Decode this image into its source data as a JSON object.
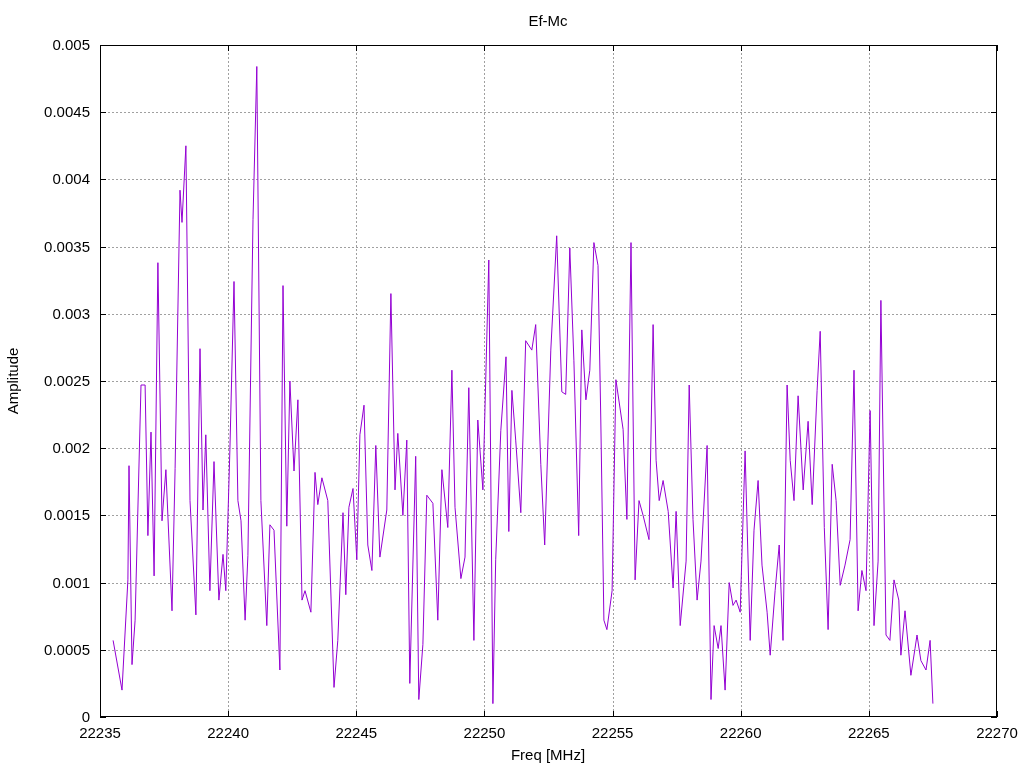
{
  "chart_data": {
    "type": "line",
    "grid": true,
    "title": "Ef-Mc",
    "xlabel": "Freq [MHz]",
    "ylabel": "Amplitude",
    "xlim": [
      22235,
      22270
    ],
    "ylim": [
      0,
      0.005
    ],
    "xticks": [
      22235,
      22240,
      22245,
      22250,
      22255,
      22260,
      22265,
      22270
    ],
    "yticks": [
      0,
      0.0005,
      0.001,
      0.0015,
      0.002,
      0.0025,
      0.003,
      0.0035,
      0.004,
      0.0045,
      0.005
    ],
    "x": [
      22235.51,
      22235.86,
      22236.09,
      22236.13,
      22236.25,
      22236.37,
      22236.6,
      22236.76,
      22236.87,
      22236.99,
      22237.11,
      22237.26,
      22237.42,
      22237.57,
      22237.81,
      22237.93,
      22238.12,
      22238.2,
      22238.35,
      22238.51,
      22238.74,
      22238.9,
      22239.02,
      22239.13,
      22239.29,
      22239.45,
      22239.64,
      22239.8,
      22239.91,
      22240.07,
      22240.23,
      22240.38,
      22240.5,
      22240.66,
      22240.77,
      22240.97,
      22241.12,
      22241.28,
      22241.51,
      22241.63,
      22241.79,
      22242.02,
      22242.14,
      22242.29,
      22242.41,
      22242.57,
      22242.72,
      22242.88,
      22243.0,
      22243.23,
      22243.39,
      22243.5,
      22243.66,
      22243.89,
      22244.13,
      22244.28,
      22244.48,
      22244.59,
      22244.71,
      22244.87,
      22245.02,
      22245.14,
      22245.3,
      22245.45,
      22245.61,
      22245.76,
      22245.92,
      22246.19,
      22246.35,
      22246.51,
      22246.62,
      22246.82,
      22246.97,
      22247.09,
      22247.32,
      22247.44,
      22247.6,
      22247.75,
      22247.99,
      22248.18,
      22248.34,
      22248.57,
      22248.73,
      22248.85,
      22249.08,
      22249.24,
      22249.39,
      22249.59,
      22249.74,
      22249.94,
      22250.17,
      22250.33,
      22250.44,
      22250.64,
      22250.84,
      22250.95,
      22251.07,
      22251.22,
      22251.42,
      22251.61,
      22251.85,
      22252.0,
      22252.2,
      22252.35,
      22252.59,
      22252.82,
      22253.02,
      22253.17,
      22253.33,
      22253.49,
      22253.68,
      22253.8,
      22253.96,
      22254.11,
      22254.27,
      22254.43,
      22254.54,
      22254.66,
      22254.78,
      22254.98,
      22255.13,
      22255.41,
      22255.56,
      22255.72,
      22255.88,
      22256.03,
      22256.19,
      22256.42,
      22256.58,
      22256.7,
      22256.82,
      22256.97,
      22257.17,
      22257.36,
      22257.48,
      22257.64,
      22257.87,
      22257.99,
      22258.14,
      22258.3,
      22258.45,
      22258.69,
      22258.84,
      22258.96,
      22259.12,
      22259.23,
      22259.39,
      22259.55,
      22259.7,
      22259.82,
      22259.98,
      22260.17,
      22260.37,
      22260.52,
      22260.68,
      22260.83,
      22261.03,
      22261.15,
      22261.34,
      22261.5,
      22261.65,
      22261.81,
      22261.93,
      22262.08,
      22262.24,
      22262.44,
      22262.63,
      22262.79,
      22262.98,
      22263.1,
      22263.26,
      22263.41,
      22263.57,
      22263.72,
      22263.88,
      22264.07,
      22264.27,
      22264.42,
      22264.58,
      22264.73,
      22264.89,
      22265.05,
      22265.2,
      22265.36,
      22265.47,
      22265.67,
      22265.82,
      22265.98,
      22266.17,
      22266.25,
      22266.41,
      22266.64,
      22266.8,
      22266.88,
      22267.03,
      22267.23,
      22267.39,
      22267.5
    ],
    "series": [
      {
        "color": "#9400d3",
        "values": [
          0.00057,
          0.0002,
          0.00102,
          0.00187,
          0.00039,
          0.00072,
          0.00247,
          0.00247,
          0.00135,
          0.00212,
          0.00105,
          0.00338,
          0.00146,
          0.00184,
          0.00079,
          0.00185,
          0.00392,
          0.00368,
          0.00425,
          0.00161,
          0.00076,
          0.00274,
          0.00154,
          0.0021,
          0.00094,
          0.0019,
          0.00087,
          0.00121,
          0.00094,
          0.00199,
          0.00324,
          0.00161,
          0.00146,
          0.00072,
          0.0012,
          0.0037,
          0.00484,
          0.00161,
          0.00068,
          0.00143,
          0.00139,
          0.00035,
          0.00321,
          0.00142,
          0.0025,
          0.00183,
          0.00236,
          0.00087,
          0.00094,
          0.00078,
          0.00182,
          0.00158,
          0.00178,
          0.00161,
          0.00022,
          0.00057,
          0.00152,
          0.00091,
          0.00156,
          0.0017,
          0.00117,
          0.0021,
          0.00232,
          0.00128,
          0.00109,
          0.00202,
          0.00119,
          0.00154,
          0.00315,
          0.00169,
          0.00211,
          0.0015,
          0.00206,
          0.00025,
          0.00194,
          0.00013,
          0.00054,
          0.00165,
          0.00159,
          0.00072,
          0.00184,
          0.00141,
          0.00258,
          0.00156,
          0.00103,
          0.00119,
          0.00245,
          0.00057,
          0.00221,
          0.00169,
          0.0034,
          0.0001,
          0.00117,
          0.00213,
          0.00268,
          0.00138,
          0.00243,
          0.00206,
          0.00152,
          0.0028,
          0.00273,
          0.00292,
          0.00188,
          0.00128,
          0.00273,
          0.00358,
          0.00242,
          0.0024,
          0.00349,
          0.00265,
          0.00135,
          0.00288,
          0.00236,
          0.00258,
          0.00353,
          0.00336,
          0.00221,
          0.00072,
          0.00065,
          0.00094,
          0.00251,
          0.00214,
          0.00147,
          0.00353,
          0.00102,
          0.00161,
          0.0015,
          0.00132,
          0.00292,
          0.00191,
          0.00161,
          0.00176,
          0.00153,
          0.00096,
          0.00153,
          0.00068,
          0.00116,
          0.00247,
          0.00147,
          0.00087,
          0.00116,
          0.00202,
          0.00013,
          0.00068,
          0.00051,
          0.00068,
          0.0002,
          0.001,
          0.00083,
          0.00087,
          0.00078,
          0.00198,
          0.00057,
          0.00139,
          0.00176,
          0.00113,
          0.00078,
          0.00046,
          0.00094,
          0.00128,
          0.00057,
          0.00247,
          0.00191,
          0.00161,
          0.00239,
          0.00169,
          0.0022,
          0.00158,
          0.00243,
          0.00287,
          0.00141,
          0.00065,
          0.00188,
          0.00161,
          0.00098,
          0.00113,
          0.00132,
          0.00258,
          0.00079,
          0.00109,
          0.00094,
          0.00228,
          0.00068,
          0.00116,
          0.0031,
          0.00061,
          0.00057,
          0.00102,
          0.00087,
          0.00046,
          0.00079,
          0.00031,
          0.00051,
          0.00061,
          0.00042,
          0.00035,
          0.00057,
          0.0001
        ]
      }
    ]
  }
}
